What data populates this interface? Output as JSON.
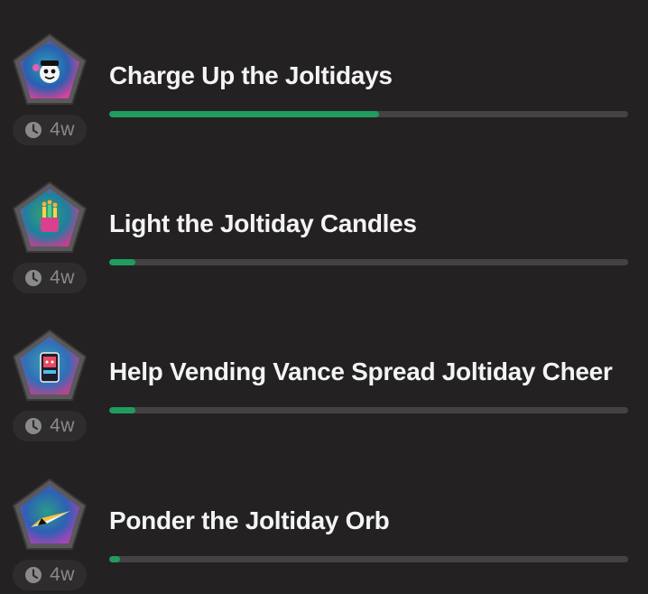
{
  "quests": [
    {
      "title": "Charge Up the Joltidays",
      "time_remaining": "4w",
      "progress": 0.52,
      "badge_art": "joltiday-mascot",
      "badge_colors": [
        "#2a5fb0",
        "#29a0b8",
        "#d6429a"
      ]
    },
    {
      "title": "Light the Joltiday Candles",
      "time_remaining": "4w",
      "progress": 0.05,
      "badge_art": "joltiday-candles",
      "badge_colors": [
        "#1e7fa0",
        "#3aa36a",
        "#c63d8f"
      ]
    },
    {
      "title": "Help Vending Vance Spread Joltiday Cheer",
      "time_remaining": "4w",
      "progress": 0.05,
      "badge_art": "vending-machine",
      "badge_colors": [
        "#2f6fb8",
        "#3c9fb0",
        "#b7448f"
      ]
    },
    {
      "title": "Ponder the Joltiday Orb",
      "time_remaining": "4w",
      "progress": 0.02,
      "badge_art": "paper-plane",
      "badge_colors": [
        "#2d60b4",
        "#2b9a8a",
        "#a544b8"
      ]
    }
  ],
  "colors": {
    "background": "#232122",
    "progress_fill": "#1f9c5e",
    "progress_track": "#444244",
    "timer_pill": "#2e2c2d"
  },
  "icons": {
    "timer": "clock-icon"
  }
}
